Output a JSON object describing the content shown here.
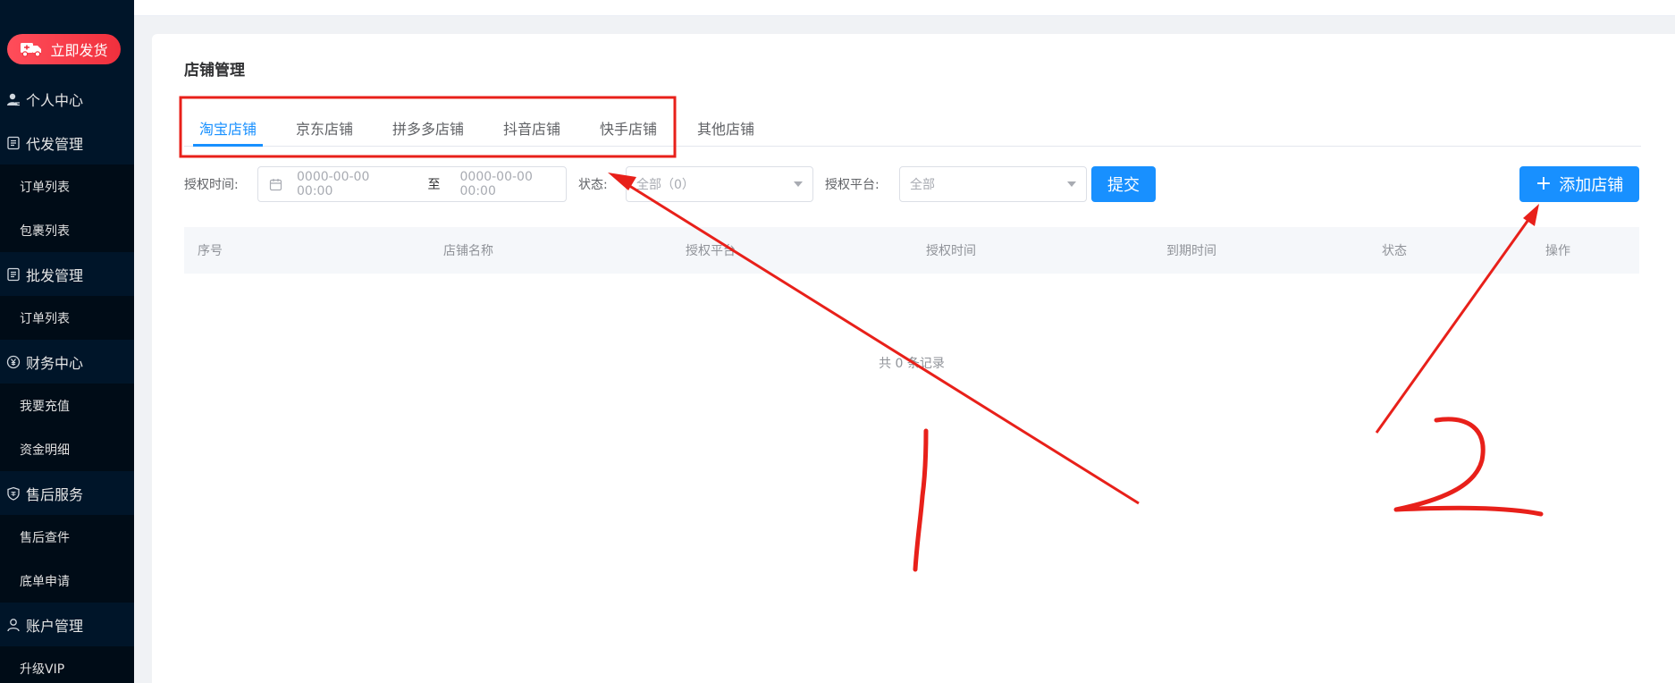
{
  "sidebar": {
    "ship_button": "立即发货",
    "menu": [
      {
        "type": "group",
        "label": "个人中心",
        "icon": "user-icon"
      },
      {
        "type": "group",
        "label": "代发管理",
        "icon": "document-icon"
      },
      {
        "type": "sub",
        "label": "订单列表"
      },
      {
        "type": "sub",
        "label": "包裹列表"
      },
      {
        "type": "group",
        "label": "批发管理",
        "icon": "document-icon"
      },
      {
        "type": "sub",
        "label": "订单列表"
      },
      {
        "type": "group",
        "label": "财务中心",
        "icon": "yen-icon"
      },
      {
        "type": "sub",
        "label": "我要充值"
      },
      {
        "type": "sub",
        "label": "资金明细"
      },
      {
        "type": "group",
        "label": "售后服务",
        "icon": "shield-icon"
      },
      {
        "type": "sub",
        "label": "售后查件"
      },
      {
        "type": "sub",
        "label": "底单申请"
      },
      {
        "type": "group",
        "label": "账户管理",
        "icon": "user-outline-icon"
      },
      {
        "type": "sub",
        "label": "升级VIP"
      }
    ]
  },
  "page": {
    "title": "店铺管理",
    "tabs": [
      "淘宝店铺",
      "京东店铺",
      "拼多多店铺",
      "抖音店铺",
      "快手店铺",
      "其他店铺"
    ],
    "active_tab": "淘宝店铺"
  },
  "filters": {
    "auth_time_label": "授权时间:",
    "start_placeholder": "0000-00-00 00:00",
    "range_separator": "至",
    "end_placeholder": "0000-00-00 00:00",
    "status_label": "状态:",
    "status_value": "全部（0）",
    "platform_label": "授权平台:",
    "platform_value": "全部",
    "submit_label": "提交",
    "add_store_label": "添加店铺"
  },
  "table": {
    "columns": [
      "序号",
      "店铺名称",
      "授权平台",
      "授权时间",
      "到期时间",
      "状态",
      "操作"
    ],
    "empty_text": "共 0 条记录"
  },
  "annotations": {
    "color": "#e8201a",
    "label_1": "1",
    "label_2": "2"
  },
  "colors": {
    "sidebar_bg": "#001529",
    "primary": "#1890ff",
    "ship_button": "#f0303d"
  }
}
